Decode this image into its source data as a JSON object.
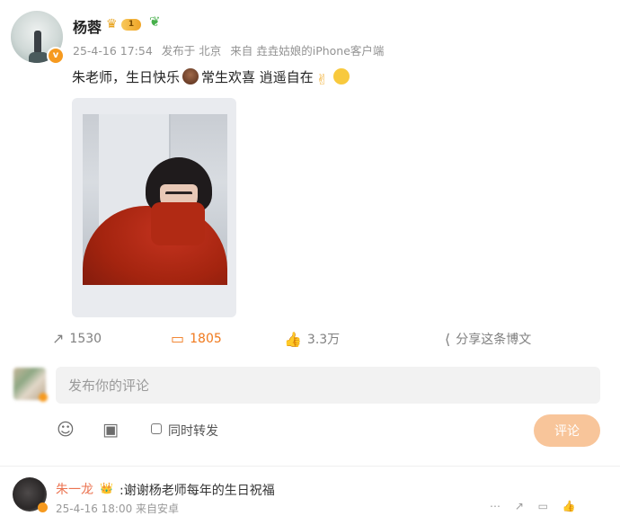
{
  "post": {
    "author": "杨蓉",
    "level_badge": "1",
    "vip_badge": "v",
    "date": "25-4-16 17:54",
    "location": "发布于 北京",
    "source": "来自 垚垚姑娘的iPhone客户端",
    "text_part1": "朱老师，生日快乐",
    "text_part2": "常生欢喜 逍遥自在",
    "emoji_v": "✌",
    "icons": {
      "avatar": "author-avatar",
      "crown": "crown-icon",
      "sprout": "sprout-icon",
      "cake": "cake-emoji",
      "smile": "smile-emoji"
    }
  },
  "actions": {
    "repost_count": "1530",
    "comment_count": "1805",
    "like_count": "3.3万",
    "share_label": "分享这条博文",
    "repost_icon": "↗",
    "comment_icon": "▭",
    "like_icon": "👍",
    "share_icon": "⟨"
  },
  "compose": {
    "placeholder": "发布你的评论",
    "repost_checkbox_label": "同时转发",
    "submit_label": "评论",
    "emoji_icon": "☺",
    "image_icon": "▣"
  },
  "comment": {
    "name": "朱一龙",
    "badge": "👑",
    "text": ":谢谢杨老师每年的生日祝福",
    "meta": "25-4-16 18:00 来自安卓",
    "trailing_icons": "⋯ ↗ ▭ 👍"
  },
  "colors": {
    "accent_orange": "#f07a1e",
    "name_orange": "#eb7350",
    "submit_bg": "#f8c59a",
    "input_bg": "#f2f2f2"
  }
}
